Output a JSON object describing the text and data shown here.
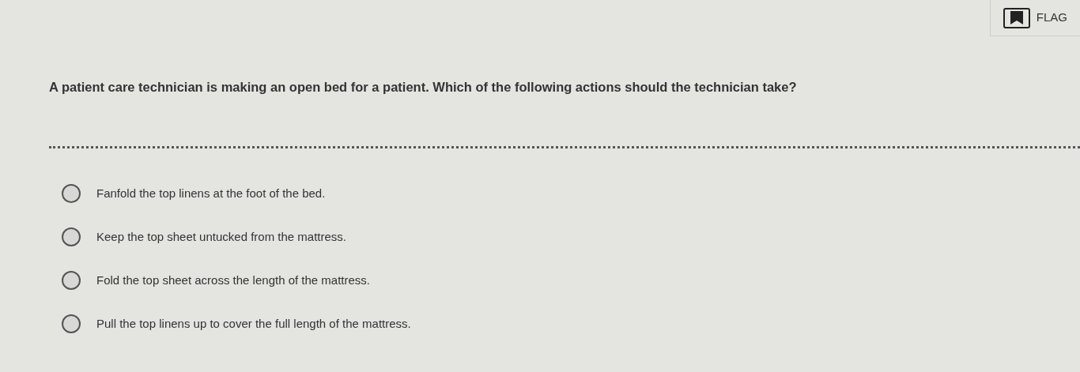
{
  "toolbar": {
    "flag_button": {
      "label": "FLAG",
      "on": false
    }
  },
  "question": {
    "text": "A patient care technician is making an open bed for a patient. Which of the following actions should the technician take?"
  },
  "options": [
    {
      "label": "Fanfold the top linens at the foot of the bed.",
      "selected": false
    },
    {
      "label": "Keep the top sheet untucked from the mattress.",
      "selected": false
    },
    {
      "label": "Fold the top sheet across the length of the mattress.",
      "selected": false
    },
    {
      "label": "Pull the top linens up to cover the full length of the mattress.",
      "selected": false
    }
  ]
}
